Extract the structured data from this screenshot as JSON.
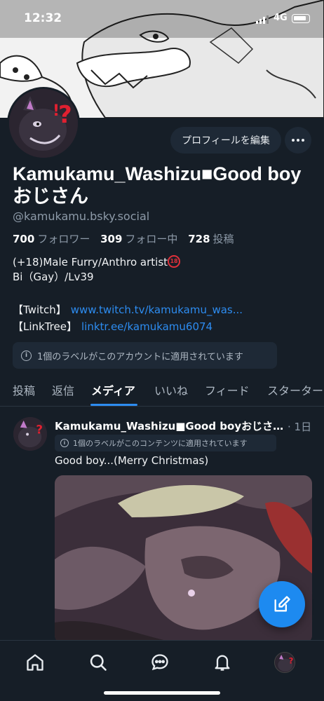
{
  "status_bar": {
    "time": "12:32",
    "network": "4G"
  },
  "profile": {
    "edit_button": "プロフィールを編集",
    "display_name": "Kamukamu_Washizu■Good boyおじさん",
    "handle": "@kamukamu.bsky.social",
    "followers_count": "700",
    "followers_label": "フォロワー",
    "following_count": "309",
    "following_label": "フォロー中",
    "posts_count": "728",
    "posts_label": "投稿",
    "bio_line1": "(+18)Male Furry/Anthro artist",
    "bio_line2": "Bi（Gay）/Lv39",
    "twitch_label": "【Twitch】",
    "twitch_link": "www.twitch.tv/kamukamu_was...",
    "linktree_label": "【LinkTree】",
    "linktree_link": "linktr.ee/kamukamu6074",
    "account_label_notice": "1個のラベルがこのアカウントに適用されています"
  },
  "tabs": [
    {
      "label": "投稿"
    },
    {
      "label": "返信"
    },
    {
      "label": "メディア"
    },
    {
      "label": "いいね"
    },
    {
      "label": "フィード"
    },
    {
      "label": "スターター"
    }
  ],
  "active_tab": "メディア",
  "post": {
    "author": "Kamukamu_Washizu■Good boyおじさ…",
    "time": "· 1日",
    "label_notice": "1個のラベルがこのコンテンツに適用されています",
    "text": "Good boy...(Merry Christmas)"
  },
  "bottom_nav": [
    "home-icon",
    "search-icon",
    "chat-icon",
    "bell-icon",
    "profile-avatar"
  ],
  "colors": {
    "background": "#161e27",
    "accent": "#2d8cf0",
    "fab": "#1d8af0",
    "pill": "#1e2936"
  }
}
